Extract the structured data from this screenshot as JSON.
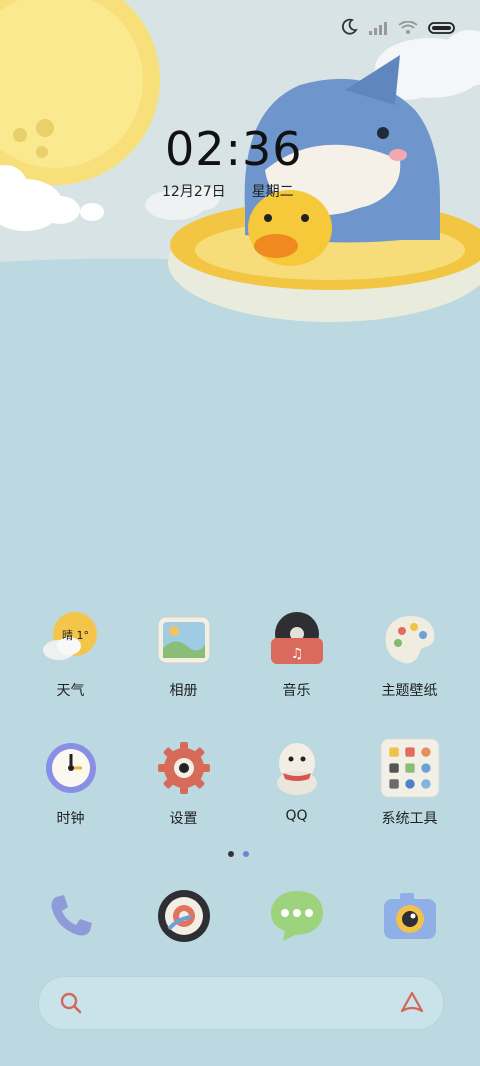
{
  "status": {
    "icons": [
      "moon-icon",
      "signal-icon",
      "wifi-icon",
      "battery-icon"
    ]
  },
  "lockscreen": {
    "time": "02:36",
    "date_day": "12月27日",
    "weekday": "星期二"
  },
  "apps_row1": [
    {
      "label": "天气",
      "icon": "weather-icon",
      "badge": "晴 1°"
    },
    {
      "label": "相册",
      "icon": "gallery-icon"
    },
    {
      "label": "音乐",
      "icon": "music-icon"
    },
    {
      "label": "主题壁纸",
      "icon": "themes-icon"
    }
  ],
  "apps_row2": [
    {
      "label": "时钟",
      "icon": "clock-icon"
    },
    {
      "label": "设置",
      "icon": "settings-icon"
    },
    {
      "label": "QQ",
      "icon": "qq-icon"
    },
    {
      "label": "系统工具",
      "icon": "folder-icon"
    }
  ],
  "dock": [
    {
      "name": "phone",
      "icon": "phone-icon"
    },
    {
      "name": "browser",
      "icon": "browser-icon"
    },
    {
      "name": "messages",
      "icon": "messages-icon"
    },
    {
      "name": "camera",
      "icon": "camera-icon"
    }
  ],
  "pager": {
    "pages": 2,
    "active": 0
  },
  "colors": {
    "sky": "#d6e2e6",
    "water": "#bcd8e0",
    "sun": "#f7e07a",
    "shark": "#6e96cc",
    "duck": "#f5c93a"
  }
}
